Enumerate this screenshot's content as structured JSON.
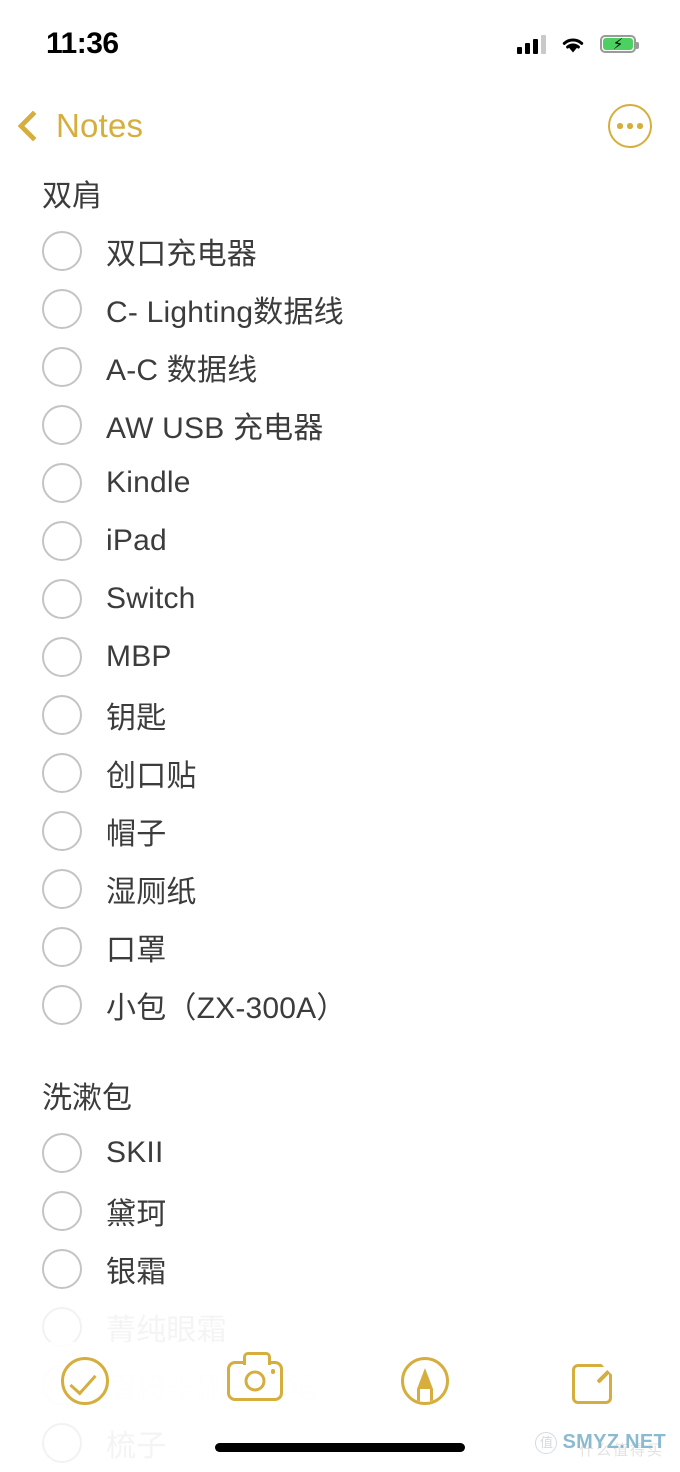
{
  "status_bar": {
    "time": "11:36",
    "signal_icon": "cellular-signal-icon",
    "signal_bars_filled": 3,
    "signal_bars_total": 4,
    "wifi_icon": "wifi-icon",
    "battery_icon": "battery-charging-icon",
    "battery_charging": true
  },
  "nav": {
    "back_label": "Notes",
    "back_icon": "chevron-left-icon",
    "more_icon": "more-options-icon"
  },
  "note": {
    "sections": [
      {
        "title": "双肩",
        "items": [
          {
            "label": "双口充电器",
            "checked": false
          },
          {
            "label": "C- Lighting数据线",
            "checked": false
          },
          {
            "label": "A-C 数据线",
            "checked": false
          },
          {
            "label": "AW USB 充电器",
            "checked": false
          },
          {
            "label": "Kindle",
            "checked": false
          },
          {
            "label": "iPad",
            "checked": false
          },
          {
            "label": "Switch",
            "checked": false
          },
          {
            "label": "MBP",
            "checked": false
          },
          {
            "label": "钥匙",
            "checked": false
          },
          {
            "label": "创口贴",
            "checked": false
          },
          {
            "label": "帽子",
            "checked": false
          },
          {
            "label": "湿厕纸",
            "checked": false
          },
          {
            "label": "口罩",
            "checked": false
          },
          {
            "label": "小包（ZX-300A）",
            "checked": false
          }
        ]
      },
      {
        "title": "洗漱包",
        "items": [
          {
            "label": "SKII",
            "checked": false
          },
          {
            "label": "黛珂",
            "checked": false
          },
          {
            "label": "银霜",
            "checked": false
          },
          {
            "label": "菁纯眼霜",
            "checked": false
          },
          {
            "label": "眉粉＋刷＋眉笔",
            "checked": false
          },
          {
            "label": "梳子",
            "checked": false
          }
        ]
      }
    ]
  },
  "toolbar": {
    "checklist_icon": "checklist-icon",
    "camera_icon": "camera-icon",
    "markup_icon": "markup-pen-icon",
    "compose_icon": "compose-icon"
  },
  "watermark": {
    "logo": "值",
    "text": "SMYZ.NET",
    "sub": "什么值得买"
  },
  "colors": {
    "accent": "#D6AE3E",
    "text": "#3c3c3c",
    "circle_border": "#c4c4c4",
    "battery_green": "#4cd061",
    "watermark_blue": "#7fb4cc"
  }
}
